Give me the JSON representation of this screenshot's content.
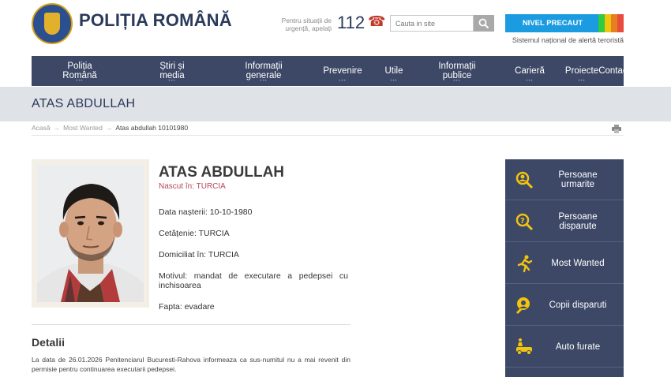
{
  "header": {
    "brand": "POLIȚIA ROMÂNĂ",
    "emergency_text": "Pentru situații de urgență, apelați",
    "emergency_number": "112",
    "search_placeholder": "Cauta in site",
    "alert_level": "NIVEL PRECAUT",
    "alert_caption": "Sistemul național de alertă teroristă",
    "alert_colors": [
      "#2ecc40",
      "#f1c40f",
      "#e67e22",
      "#e74c3c"
    ]
  },
  "nav": [
    {
      "label": "Poliția\nRomână"
    },
    {
      "label": "Știri și\nmedia"
    },
    {
      "label": "Informații\ngenerale"
    },
    {
      "label": "Prevenire"
    },
    {
      "label": "Utile"
    },
    {
      "label": "Informații\npublice"
    },
    {
      "label": "Carieră"
    },
    {
      "label": "Proiecte"
    },
    {
      "label": "Contact"
    }
  ],
  "page": {
    "band_title": "ATAS ABDULLAH",
    "breadcrumb": [
      "Acasă",
      "Most Wanted",
      "Atas abdullah 10101980"
    ]
  },
  "profile": {
    "name": "ATAS ABDULLAH",
    "born": "Nascut în: TURCIA",
    "birth_date": "Data nașterii: 10-10-1980",
    "citizenship": "Cetățenie: TURCIA",
    "residence": "Domiciliat în: TURCIA",
    "motive": "Motivul: mandat de executare a pedepsei cu inchisoarea",
    "deed": "Fapta: evadare"
  },
  "details": {
    "heading": "Detalii",
    "text": "La data de 26.01.2026 Penitenciarul Bucuresti-Rahova informeaza ca sus-numitul nu a mai revenit din permisie pentru continuarea executarii pedepsei."
  },
  "sidebar": [
    {
      "label": "Persoane\nurmarite",
      "icon": "person-search-icon"
    },
    {
      "label": "Persoane\ndisparute",
      "icon": "person-missing-icon"
    },
    {
      "label": "Most Wanted",
      "icon": "running-man-icon"
    },
    {
      "label": "Copii disparuti",
      "icon": "child-search-icon"
    },
    {
      "label": "Auto furate",
      "icon": "stolen-car-icon"
    }
  ]
}
